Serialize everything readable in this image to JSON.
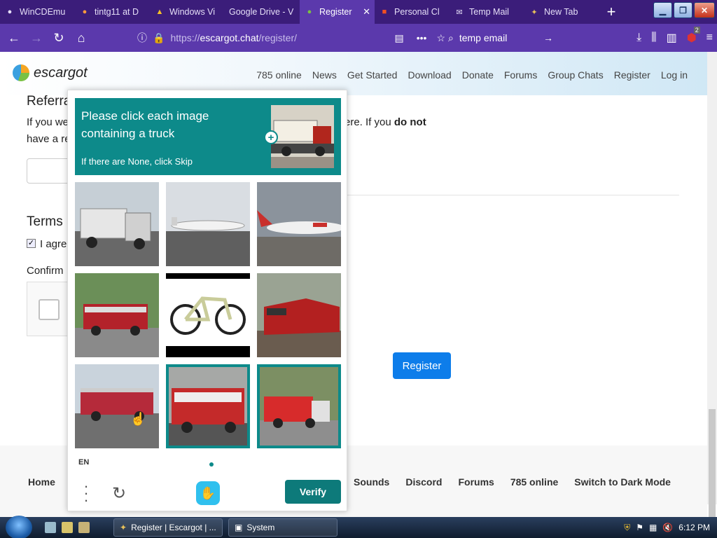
{
  "browser": {
    "tabs": [
      {
        "label": "WinCDEmu",
        "icon": "github-icon",
        "active": false
      },
      {
        "label": "tintg11 at D",
        "icon": "firefox-icon",
        "active": false
      },
      {
        "label": "Windows Vi",
        "icon": "google-drive-icon",
        "active": false
      },
      {
        "label": "Google Drive - V",
        "icon": "none",
        "active": false
      },
      {
        "label": "Register",
        "icon": "escargot-icon",
        "active": true
      },
      {
        "label": "Personal Cl",
        "icon": "microsoft-icon",
        "active": false
      },
      {
        "label": "Temp Mail",
        "icon": "mail-icon",
        "active": false
      },
      {
        "label": "New Tab",
        "icon": "newtab-icon",
        "active": false
      }
    ],
    "url": {
      "scheme": "https://",
      "host": "escargot.chat",
      "path": "/register/"
    },
    "search_text": "temp email",
    "badge_count": "2"
  },
  "site": {
    "brand": "escargot",
    "nav": [
      "785 online",
      "News",
      "Get Started",
      "Download",
      "Donate",
      "Forums",
      "Group Chats",
      "Register",
      "Log in"
    ]
  },
  "form": {
    "referral_heading": "Referra",
    "referral_text_line1": "If you we",
    "referral_text_line2": "have a re",
    "referral_tail": "ere. If you",
    "referral_tail_bold": "do not",
    "terms_heading": "Terms",
    "agree_label": "I agre",
    "confirm_label": "Confirm",
    "register_button": "Register"
  },
  "captcha": {
    "prompt": "Please click each image containing a truck",
    "hint": "If there are None, click Skip",
    "tiles": [
      {
        "subject": "truck",
        "selected": false
      },
      {
        "subject": "airplane",
        "selected": false
      },
      {
        "subject": "airplane",
        "selected": false
      },
      {
        "subject": "fire-truck",
        "selected": false
      },
      {
        "subject": "bicycle",
        "selected": false
      },
      {
        "subject": "train",
        "selected": false
      },
      {
        "subject": "fire-truck",
        "selected": false
      },
      {
        "subject": "fire-truck",
        "selected": true
      },
      {
        "subject": "fire-truck",
        "selected": true
      }
    ],
    "language": "EN",
    "verify_button": "Verify"
  },
  "footer": {
    "left_link": "Home",
    "links": [
      "Sounds",
      "Discord",
      "Forums",
      "785 online",
      "Switch to Dark Mode"
    ]
  },
  "taskbar": {
    "items": [
      "Register | Escargot | ...",
      "System"
    ],
    "clock": "6:12 PM"
  },
  "colors": {
    "tabbar": "#3b1d7a",
    "navbar": "#5b39ac",
    "captcha_teal": "#0d8a8a",
    "register_blue": "#0d7dea"
  }
}
